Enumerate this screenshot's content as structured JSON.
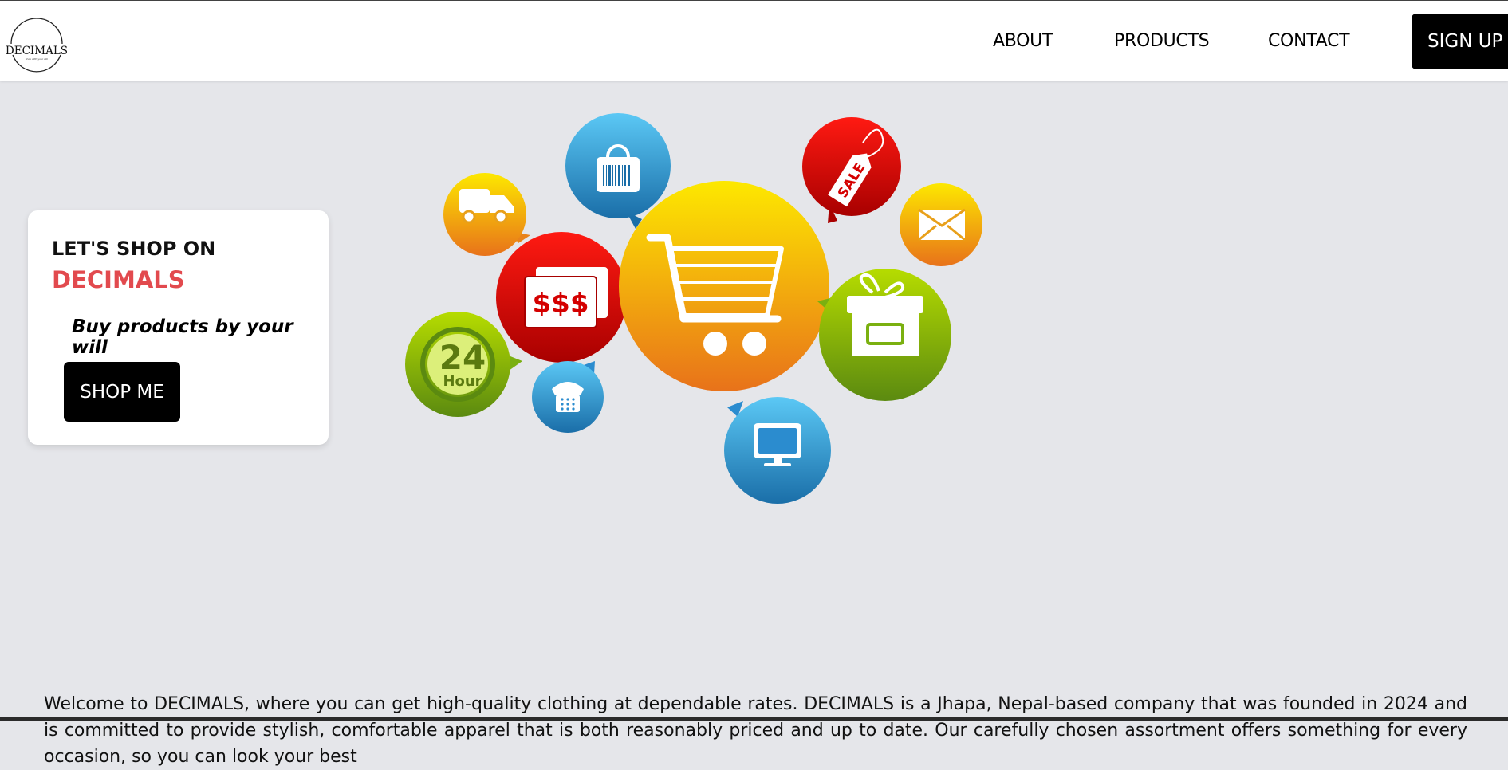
{
  "header": {
    "logo_text": "DECIMALS",
    "logo_subtext": "shop with your will",
    "nav": [
      {
        "label": "ABOUT"
      },
      {
        "label": "PRODUCTS"
      },
      {
        "label": "CONTACT"
      }
    ],
    "signup_label": "SIGN UP"
  },
  "hero_card": {
    "title": "LET'S SHOP ON",
    "brand": "DECIMALS",
    "tagline": "Buy products by your will",
    "button_label": "SHOP ME"
  },
  "hero_image": {
    "badges": {
      "money": "$$$",
      "hours_number": "24",
      "hours_word": "Hour",
      "sale": "SALE"
    },
    "icons": [
      "shopping-cart-icon",
      "shopping-bag-icon",
      "delivery-truck-icon",
      "money-icon",
      "24-hour-icon",
      "telephone-icon",
      "sale-tag-icon",
      "envelope-icon",
      "gift-box-icon",
      "monitor-icon"
    ]
  },
  "welcome_text": "Welcome to DECIMALS, where you can get high-quality clothing at dependable rates. DECIMALS is a Jhapa, Nepal-based company that was founded in 2024 and is committed to provide stylish, comfortable apparel that is both reasonably priced and up to date. Our carefully chosen assortment offers something for every occasion, so you can look your best",
  "colors": {
    "brand_red": "#e24a4e",
    "page_bg": "#e5e6ea",
    "button_bg": "#000000"
  }
}
